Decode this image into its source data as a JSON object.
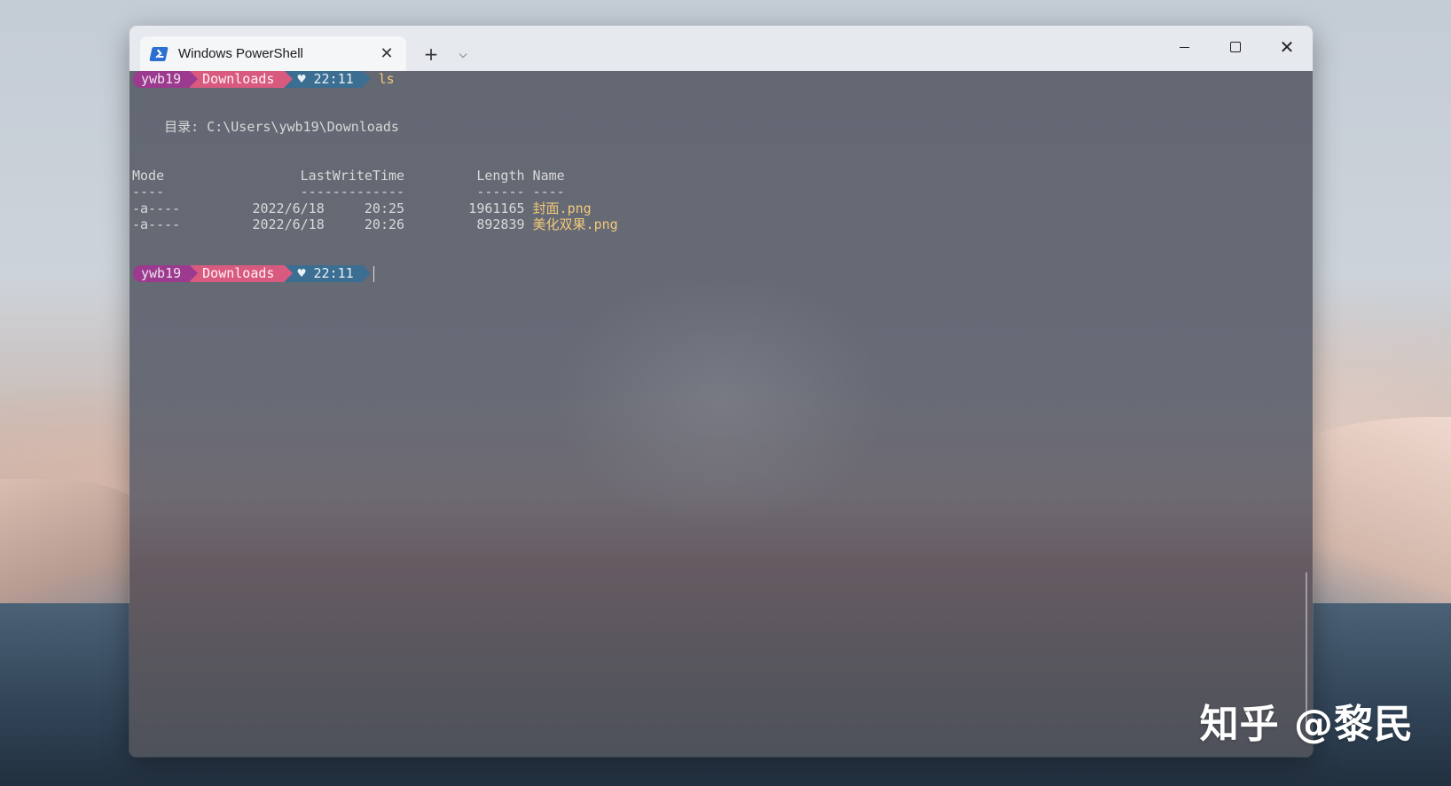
{
  "window": {
    "tab_title": "Windows PowerShell",
    "tab_close_glyph": "✕",
    "new_tab_glyph": "+",
    "dropdown_glyph": "⌵",
    "close_glyph": "✕"
  },
  "prompt1": {
    "user": "ywb19",
    "dir": "Downloads",
    "time": "♥ 22:11",
    "command": "ls"
  },
  "listing": {
    "directory_line": "    目录: C:\\Users\\ywb19\\Downloads",
    "header_line": "Mode                 LastWriteTime         Length Name",
    "divider_line": "----                 -------------         ------ ----",
    "rows": [
      {
        "prefix": "-a----         2022/6/18     20:25        1961165 ",
        "name": "封面.png"
      },
      {
        "prefix": "-a----         2022/6/18     20:26         892839 ",
        "name": "美化双果.png"
      }
    ]
  },
  "prompt2": {
    "user": "ywb19",
    "dir": "Downloads",
    "time": "♥ 22:11"
  },
  "watermark": "知乎 @黎民",
  "colors": {
    "user_segment": "#9b3a8f",
    "dir_segment": "#d95a7f",
    "time_segment": "#3b6e91",
    "highlight_text": "#f2c879"
  }
}
